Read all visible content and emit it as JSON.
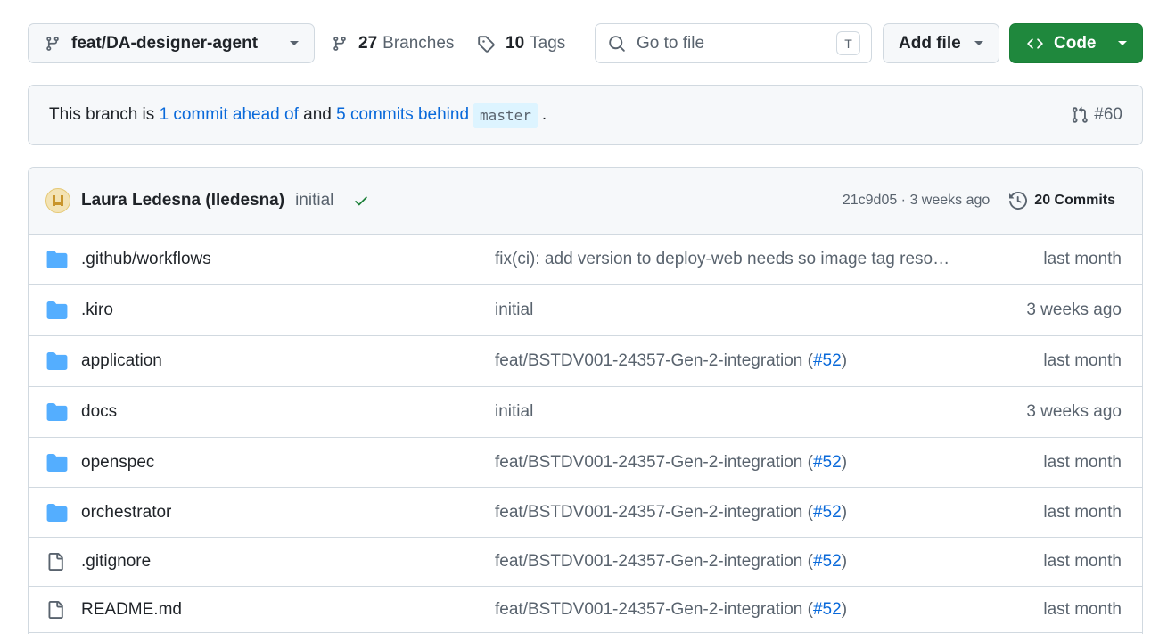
{
  "toolbar": {
    "branch_name": "feat/DA-designer-agent",
    "branches_count": "27",
    "branches_label": "Branches",
    "tags_count": "10",
    "tags_label": "Tags",
    "search_placeholder": "Go to file",
    "search_shortcut": "T",
    "add_file_label": "Add file",
    "code_label": "Code",
    "code_color": "#1f883d"
  },
  "banner": {
    "prefix": "This branch is",
    "ahead_link": "1 commit ahead of",
    "middle": "and",
    "behind_link": "5 commits behind",
    "base_branch": "master",
    "suffix": ".",
    "pr_number": "#60"
  },
  "latest_commit": {
    "author": "Laura Ledesna (lledesna)",
    "message": "initial",
    "status": "success",
    "sha_and_age": "21c9d05 · 3 weeks ago",
    "commits_label": "20 Commits"
  },
  "files": [
    {
      "type": "folder",
      "name": ".github/workflows",
      "message": "fix(ci): add version to deploy-web needs so image tag reso…",
      "pr": "",
      "pr_close": "",
      "age": "last month"
    },
    {
      "type": "folder",
      "name": ".kiro",
      "message": "initial",
      "pr": "",
      "pr_close": "",
      "age": "3 weeks ago"
    },
    {
      "type": "folder",
      "name": "application",
      "message": "feat/BSTDV001-24357-Gen-2-integration (",
      "pr": "#52",
      "pr_close": ")",
      "age": "last month"
    },
    {
      "type": "folder",
      "name": "docs",
      "message": "initial",
      "pr": "",
      "pr_close": "",
      "age": "3 weeks ago"
    },
    {
      "type": "folder",
      "name": "openspec",
      "message": "feat/BSTDV001-24357-Gen-2-integration (",
      "pr": "#52",
      "pr_close": ")",
      "age": "last month"
    },
    {
      "type": "folder",
      "name": "orchestrator",
      "message": "feat/BSTDV001-24357-Gen-2-integration (",
      "pr": "#52",
      "pr_close": ")",
      "age": "last month"
    },
    {
      "type": "file",
      "name": ".gitignore",
      "message": "feat/BSTDV001-24357-Gen-2-integration (",
      "pr": "#52",
      "pr_close": ")",
      "age": "last month"
    },
    {
      "type": "file",
      "name": "README.md",
      "message": "feat/BSTDV001-24357-Gen-2-integration (",
      "pr": "#52",
      "pr_close": ")",
      "age": "last month"
    }
  ]
}
